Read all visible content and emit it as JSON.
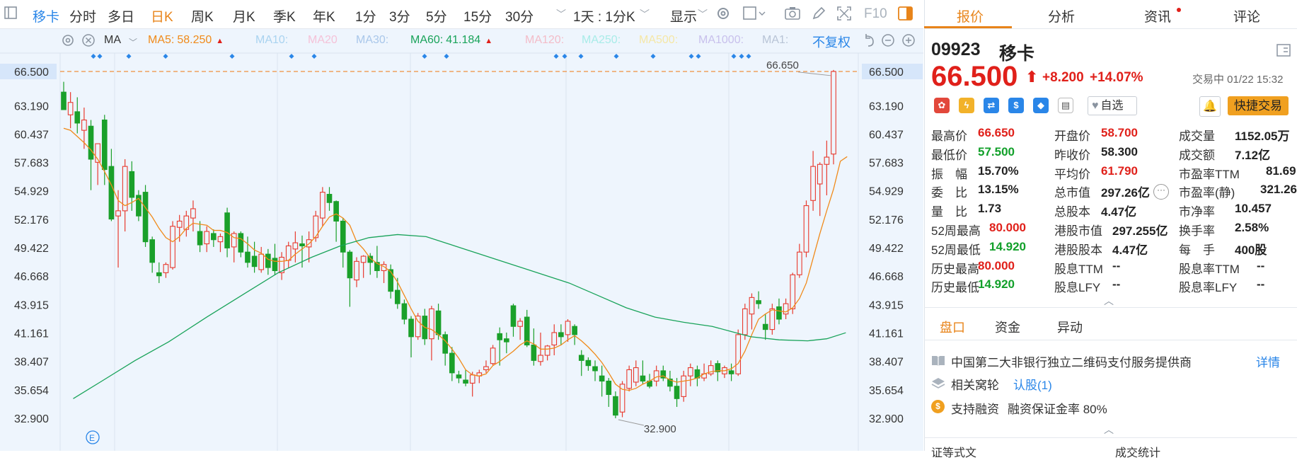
{
  "toolbar": {
    "stock_name": "移卡",
    "periods": [
      "分时",
      "多日",
      "日K",
      "周K",
      "月K",
      "季K",
      "年K",
      "1分",
      "3分",
      "5分",
      "15分",
      "30分"
    ],
    "active_period": "日K",
    "multi_period": "1天 : 1分K",
    "display": "显示",
    "f10": "F10"
  },
  "ma_bar": {
    "ma_label": "MA",
    "items": [
      {
        "label": "MA5:",
        "value": "58.250",
        "color": "#f08a1a",
        "arrow": "▲"
      },
      {
        "label": "MA10:",
        "value": "",
        "color": "#a9d3f0",
        "arrow": ""
      },
      {
        "label": "MA20",
        "value": "",
        "color": "#f5c2d8",
        "arrow": ""
      },
      {
        "label": "MA30:",
        "value": "",
        "color": "#a9c7ea",
        "arrow": ""
      },
      {
        "label": "MA60:",
        "value": "41.184",
        "color": "#19a35a",
        "arrow": "▲"
      },
      {
        "label": "MA120:",
        "value": "",
        "color": "#f3bcc8",
        "arrow": ""
      },
      {
        "label": "MA250:",
        "value": "",
        "color": "#a8ece8",
        "arrow": ""
      },
      {
        "label": "MA500:",
        "value": "",
        "color": "#f5e7a6",
        "arrow": ""
      },
      {
        "label": "MA1000:",
        "value": "",
        "color": "#c8c0ec",
        "arrow": ""
      },
      {
        "label": "MA1:",
        "value": "",
        "color": "#b8c4d6",
        "arrow": ""
      }
    ],
    "adjust": "不复权"
  },
  "chart_data": {
    "type": "candlestick",
    "y_ticks": [
      "66.500",
      "63.190",
      "60.437",
      "57.683",
      "54.929",
      "52.176",
      "49.422",
      "46.668",
      "43.915",
      "41.161",
      "38.407",
      "35.654",
      "32.900"
    ],
    "ylim": [
      32.9,
      66.65
    ],
    "current_price_label": "66.500",
    "high_marker": "66.650",
    "low_marker": "32.900",
    "event_marker": "E",
    "candles": [
      [
        64.5,
        65.5,
        63.0,
        62.8
      ],
      [
        62.3,
        64.5,
        61.0,
        63.5
      ],
      [
        62.6,
        64.0,
        60.5,
        61.5
      ],
      [
        60.8,
        63.0,
        59.0,
        61.8
      ],
      [
        61.2,
        61.8,
        55.0,
        58.0
      ],
      [
        57.7,
        59.5,
        55.5,
        59.5
      ],
      [
        61.8,
        62.3,
        55.5,
        57.0
      ],
      [
        57.3,
        59.0,
        52.0,
        52.2
      ],
      [
        52.5,
        55.0,
        47.5,
        53.0
      ],
      [
        53.0,
        58.0,
        51.0,
        57.3
      ],
      [
        56.8,
        57.8,
        53.0,
        54.3
      ],
      [
        54.5,
        55.0,
        52.0,
        52.5
      ],
      [
        54.8,
        55.5,
        49.5,
        50.0
      ],
      [
        50.2,
        50.5,
        47.0,
        48.0
      ],
      [
        47.0,
        48.0,
        46.0,
        46.7
      ],
      [
        47.0,
        48.0,
        46.5,
        47.8
      ],
      [
        47.5,
        52.0,
        47.3,
        51.5
      ],
      [
        51.4,
        52.6,
        50.0,
        52.0
      ],
      [
        51.2,
        53.0,
        50.5,
        52.5
      ],
      [
        52.3,
        54.0,
        51.0,
        53.2
      ],
      [
        51.0,
        52.0,
        49.0,
        49.7
      ],
      [
        49.8,
        51.5,
        49.0,
        51.0
      ],
      [
        50.8,
        51.2,
        49.5,
        50.2
      ],
      [
        50.0,
        50.8,
        49.0,
        50.5
      ],
      [
        52.8,
        53.3,
        48.5,
        49.4
      ],
      [
        49.5,
        51.0,
        48.0,
        50.8
      ],
      [
        50.8,
        51.0,
        48.5,
        49.0
      ],
      [
        49.0,
        50.5,
        47.5,
        48.0
      ],
      [
        48.6,
        50.0,
        47.0,
        47.6
      ],
      [
        47.3,
        49.5,
        47.0,
        48.8
      ],
      [
        48.8,
        49.3,
        46.8,
        47.5
      ],
      [
        48.4,
        49.8,
        46.8,
        47.2
      ],
      [
        47.0,
        49.0,
        46.3,
        48.5
      ],
      [
        48.2,
        50.0,
        47.5,
        49.6
      ],
      [
        49.3,
        51.0,
        48.0,
        49.9
      ],
      [
        49.8,
        50.6,
        47.5,
        49.6
      ],
      [
        49.5,
        51.0,
        48.0,
        50.2
      ],
      [
        50.4,
        53.0,
        50.0,
        52.5
      ],
      [
        52.3,
        55.3,
        51.5,
        54.8
      ],
      [
        54.6,
        55.3,
        53.0,
        53.8
      ],
      [
        53.9,
        54.0,
        50.0,
        52.0
      ],
      [
        52.0,
        52.3,
        47.5,
        49.0
      ],
      [
        49.0,
        49.2,
        43.7,
        46.5
      ],
      [
        46.3,
        48.5,
        45.6,
        48.1
      ],
      [
        48.0,
        48.7,
        46.5,
        48.6
      ],
      [
        48.6,
        48.9,
        46.8,
        48.0
      ],
      [
        48.0,
        49.6,
        46.5,
        47.2
      ],
      [
        47.2,
        48.1,
        46.0,
        47.8
      ],
      [
        47.3,
        47.8,
        44.5,
        45.2
      ],
      [
        45.3,
        46.5,
        43.5,
        44.0
      ],
      [
        44.0,
        44.4,
        42.0,
        42.5
      ],
      [
        42.5,
        42.8,
        38.8,
        40.8
      ],
      [
        40.8,
        43.1,
        40.5,
        42.8
      ],
      [
        42.8,
        43.5,
        40.0,
        40.6
      ],
      [
        40.6,
        43.8,
        38.5,
        43.5
      ],
      [
        43.3,
        44.0,
        40.5,
        41.0
      ],
      [
        41.0,
        41.3,
        38.0,
        39.2
      ],
      [
        39.2,
        39.8,
        36.5,
        37.3
      ],
      [
        37.1,
        37.5,
        36.3,
        36.8
      ],
      [
        36.6,
        37.6,
        36.0,
        36.3
      ],
      [
        36.3,
        37.4,
        35.0,
        37.1
      ],
      [
        37.0,
        37.6,
        36.3,
        37.3
      ],
      [
        37.6,
        38.5,
        37.3,
        37.9
      ],
      [
        38.2,
        40.0,
        38.0,
        39.7
      ],
      [
        41.1,
        41.7,
        38.0,
        40.5
      ],
      [
        40.6,
        41.2,
        39.2,
        40.3
      ],
      [
        43.8,
        44.0,
        40.8,
        41.8
      ],
      [
        41.8,
        42.6,
        40.5,
        42.3
      ],
      [
        42.7,
        43.4,
        39.8,
        40.0
      ],
      [
        40.0,
        41.6,
        38.0,
        38.5
      ],
      [
        38.4,
        41.2,
        38.0,
        39.0
      ],
      [
        39.0,
        40.0,
        38.5,
        39.9
      ],
      [
        40.0,
        42.0,
        39.0,
        41.2
      ],
      [
        41.2,
        42.0,
        40.0,
        40.8
      ],
      [
        41.0,
        42.5,
        40.3,
        42.3
      ],
      [
        41.8,
        42.0,
        40.0,
        41.0
      ],
      [
        39.0,
        39.5,
        37.0,
        38.5
      ],
      [
        38.5,
        38.8,
        37.5,
        38.0
      ],
      [
        37.9,
        38.5,
        36.5,
        37.5
      ],
      [
        37.0,
        38.0,
        35.0,
        36.5
      ],
      [
        36.5,
        36.8,
        34.0,
        35.2
      ],
      [
        35.0,
        35.5,
        32.9,
        33.2
      ],
      [
        33.5,
        36.5,
        33.0,
        36.2
      ],
      [
        35.8,
        38.0,
        35.5,
        37.6
      ],
      [
        36.4,
        38.5,
        36.0,
        37.8
      ],
      [
        37.0,
        38.5,
        36.2,
        36.5
      ],
      [
        36.5,
        37.2,
        35.8,
        36.0
      ],
      [
        36.5,
        38.0,
        36.0,
        37.5
      ],
      [
        37.5,
        38.0,
        36.5,
        36.8
      ],
      [
        36.7,
        37.5,
        35.5,
        36.0
      ],
      [
        36.0,
        36.8,
        34.0,
        34.8
      ],
      [
        35.0,
        37.5,
        34.5,
        37.0
      ],
      [
        37.0,
        38.2,
        36.0,
        37.8
      ],
      [
        37.6,
        38.0,
        36.0,
        36.8
      ],
      [
        36.8,
        38.2,
        36.5,
        37.2
      ],
      [
        37.2,
        38.5,
        37.0,
        38.0
      ],
      [
        38.2,
        38.5,
        36.5,
        37.4
      ],
      [
        37.2,
        38.0,
        36.8,
        37.8
      ],
      [
        37.5,
        38.2,
        36.5,
        37.2
      ],
      [
        37.2,
        41.5,
        37.0,
        41.0
      ],
      [
        41.0,
        44.0,
        40.5,
        43.5
      ],
      [
        43.0,
        45.0,
        41.5,
        44.6
      ],
      [
        44.3,
        45.2,
        43.5,
        44.0
      ],
      [
        42.0,
        43.0,
        40.5,
        41.5
      ],
      [
        41.5,
        44.0,
        41.0,
        43.5
      ],
      [
        43.7,
        44.5,
        42.0,
        42.5
      ],
      [
        43.0,
        44.5,
        42.5,
        44.0
      ],
      [
        43.5,
        47.0,
        43.0,
        46.8
      ],
      [
        46.8,
        49.8,
        46.5,
        49.0
      ],
      [
        49.0,
        54.0,
        48.5,
        53.5
      ],
      [
        54.0,
        58.8,
        53.0,
        57.3
      ],
      [
        55.6,
        57.7,
        52.5,
        57.5
      ],
      [
        57.5,
        59.8,
        54.5,
        58.2
      ],
      [
        58.5,
        66.65,
        57.5,
        66.5
      ]
    ],
    "ma5": [
      61.0,
      60.8,
      60.2,
      59.6,
      58.9,
      58.0,
      56.8,
      55.5,
      54.0,
      53.5,
      53.8,
      54.2,
      53.3,
      52.4,
      51.3,
      50.4,
      50.0,
      50.5,
      51.3,
      51.8,
      51.7,
      51.6,
      51.1,
      51.1,
      50.9,
      50.4,
      50.3,
      49.8,
      49.2,
      48.9,
      48.3,
      48.1,
      48.1,
      48.2,
      48.8,
      49.3,
      49.8,
      50.5,
      51.5,
      52.4,
      52.7,
      52.3,
      51.6,
      50.0,
      49.3,
      48.4,
      47.9,
      47.6,
      47.1,
      46.1,
      44.8,
      43.5,
      42.3,
      41.7,
      41.5,
      41.0,
      40.4,
      39.6,
      38.7,
      37.6,
      37.1,
      37.0,
      37.2,
      38.0,
      38.4,
      38.9,
      39.4,
      40.0,
      40.4,
      40.1,
      39.6,
      39.6,
      39.7,
      40.0,
      40.5,
      40.9,
      40.4,
      39.8,
      39.1,
      38.3,
      37.3,
      36.2,
      35.7,
      35.6,
      35.8,
      36.2,
      36.5,
      36.9,
      37.0,
      36.6,
      36.4,
      36.5,
      36.6,
      36.8,
      37.2,
      37.4,
      37.5,
      37.5,
      37.7,
      38.2,
      39.4,
      41.0,
      42.5,
      43.0,
      43.4,
      43.3,
      43.2,
      43.6,
      44.5,
      46.0,
      48.4,
      50.8,
      53.0,
      55.1,
      57.8,
      58.25
    ],
    "ma60": [
      null,
      null,
      null,
      null,
      null,
      null,
      null,
      null,
      null,
      null,
      null,
      null,
      null,
      null,
      null,
      null,
      null,
      null,
      null,
      null,
      null,
      null,
      null,
      null,
      null,
      null,
      null,
      null,
      null,
      null,
      null,
      null,
      null,
      null,
      null,
      null,
      null,
      null,
      null,
      null,
      null,
      null,
      null,
      null,
      null,
      null,
      null,
      null,
      null,
      null,
      null,
      null,
      null,
      null,
      null,
      null,
      null,
      null,
      null,
      null
    ],
    "ma60_path": [
      [
        2,
        34.8
      ],
      [
        8,
        36.5
      ],
      [
        15,
        38.5
      ],
      [
        22,
        40.3
      ],
      [
        30,
        42.7
      ],
      [
        38,
        45.0
      ],
      [
        45,
        47.0
      ],
      [
        52,
        48.5
      ],
      [
        58,
        49.6
      ],
      [
        64,
        50.4
      ],
      [
        70,
        50.7
      ],
      [
        76,
        50.5
      ],
      [
        82,
        49.6
      ],
      [
        88,
        48.7
      ],
      [
        94,
        47.8
      ],
      [
        100,
        46.9
      ],
      [
        106,
        46.0
      ],
      [
        112,
        44.8
      ],
      [
        118,
        43.6
      ],
      [
        124,
        42.7
      ],
      [
        130,
        42.2
      ],
      [
        136,
        41.8
      ],
      [
        140,
        41.3
      ],
      [
        144,
        40.8
      ],
      [
        150,
        40.5
      ],
      [
        156,
        40.4
      ],
      [
        160,
        40.6
      ],
      [
        164,
        41.184
      ]
    ]
  },
  "panel": {
    "tabs": [
      "报价",
      "分析",
      "资讯",
      "评论"
    ],
    "active_tab": "报价",
    "code": "09923",
    "name": "移卡",
    "price": "66.500",
    "change": "+8.200",
    "change_pct": "+14.07%",
    "status": "交易中 01/22 15:32",
    "watch": "自选",
    "trade": "快捷交易",
    "stats": [
      {
        "label": "最高价",
        "value": "66.650",
        "cls": "red"
      },
      {
        "label": "开盘价",
        "value": "58.700",
        "cls": "red"
      },
      {
        "label": "成交量",
        "value": "1152.05万",
        "cls": "dark"
      },
      {
        "label": "最低价",
        "value": "57.500",
        "cls": "green"
      },
      {
        "label": "昨收价",
        "value": "58.300",
        "cls": "dark"
      },
      {
        "label": "成交额",
        "value": "7.12亿",
        "cls": "dark"
      },
      {
        "label": "振　幅",
        "value": "15.70%",
        "cls": "dark"
      },
      {
        "label": "平均价",
        "value": "61.790",
        "cls": "red"
      },
      {
        "label": "市盈率TTM",
        "value": "81.69",
        "cls": "dark"
      },
      {
        "label": "委　比",
        "value": "13.15%",
        "cls": "dark"
      },
      {
        "label": "总市值",
        "value": "297.26亿",
        "cls": "dark"
      },
      {
        "label": "市盈率(静)",
        "value": "321.26",
        "cls": "dark"
      },
      {
        "label": "量　比",
        "value": "1.73",
        "cls": "dark"
      },
      {
        "label": "总股本",
        "value": "4.47亿",
        "cls": "dark"
      },
      {
        "label": "市净率",
        "value": "10.457",
        "cls": "dark"
      },
      {
        "label": "52周最高",
        "value": "80.000",
        "cls": "red"
      },
      {
        "label": "港股市值",
        "value": "297.255亿",
        "cls": "dark"
      },
      {
        "label": "换手率",
        "value": "2.58%",
        "cls": "dark"
      },
      {
        "label": "52周最低",
        "value": "14.920",
        "cls": "green"
      },
      {
        "label": "港股股本",
        "value": "4.47亿",
        "cls": "dark"
      },
      {
        "label": "每　手",
        "value": "400股",
        "cls": "dark"
      },
      {
        "label": "历史最高",
        "value": "80.000",
        "cls": "red"
      },
      {
        "label": "股息TTM",
        "value": "--",
        "cls": "dark"
      },
      {
        "label": "股息率TTM",
        "value": "--",
        "cls": "dark"
      },
      {
        "label": "历史最低",
        "value": "14.920",
        "cls": "green"
      },
      {
        "label": "股息LFY",
        "value": "--",
        "cls": "dark"
      },
      {
        "label": "股息率LFY",
        "value": "--",
        "cls": "dark"
      }
    ],
    "subtabs": [
      "盘口",
      "资金",
      "异动"
    ],
    "active_subtab": "盘口",
    "info1": "中国第二大非银行独立二维码支付服务提供商",
    "detail": "详情",
    "info2_label": "相关窝轮",
    "info2_link": "认股(1)",
    "info3": "支持融资",
    "info3_b": "融资保证金率 80%",
    "bottom_left": "证等式文",
    "bottom_right": "成交统计"
  }
}
